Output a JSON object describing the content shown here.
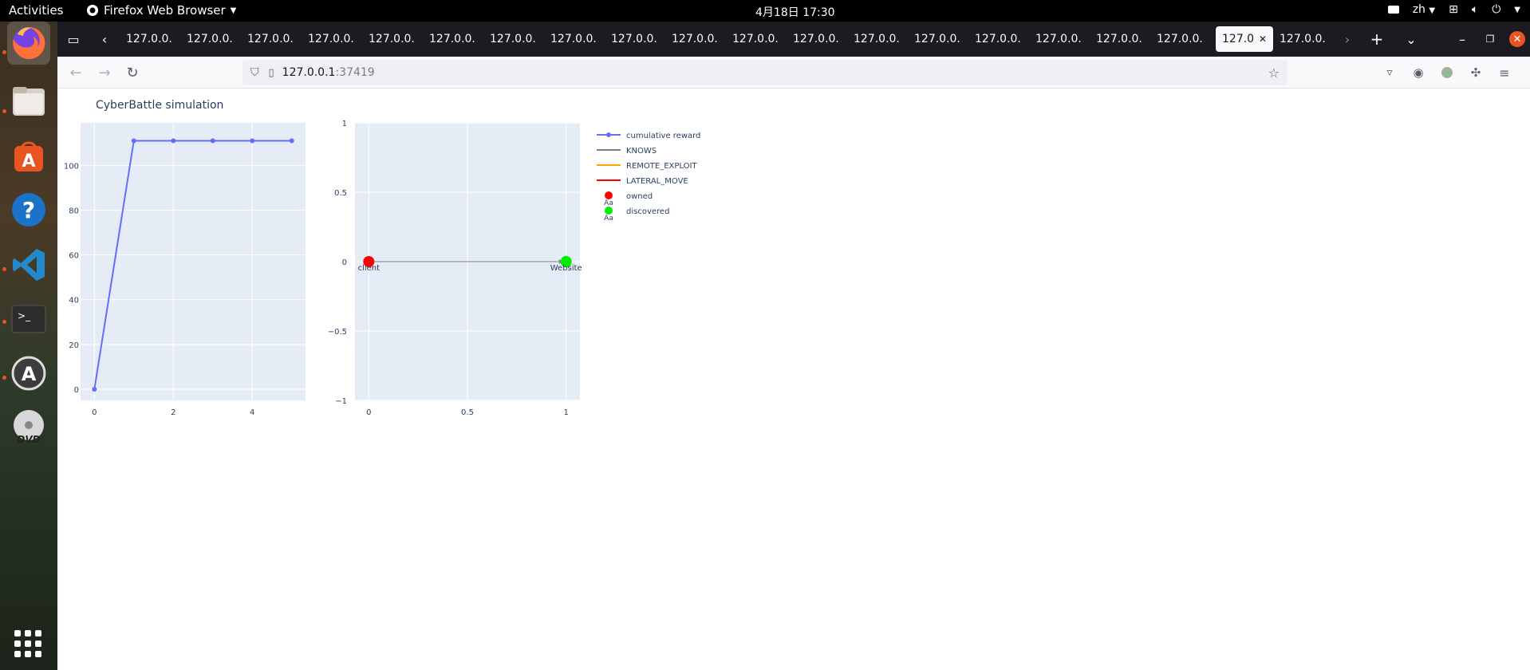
{
  "topbar": {
    "activities": "Activities",
    "app_name": "Firefox Web Browser",
    "clock": "4月18日  17:30",
    "input_method": "zh"
  },
  "browser": {
    "tabs": [
      {
        "label": "127.0.0."
      },
      {
        "label": "127.0.0."
      },
      {
        "label": "127.0.0."
      },
      {
        "label": "127.0.0."
      },
      {
        "label": "127.0.0."
      },
      {
        "label": "127.0.0."
      },
      {
        "label": "127.0.0."
      },
      {
        "label": "127.0.0."
      },
      {
        "label": "127.0.0."
      },
      {
        "label": "127.0.0."
      },
      {
        "label": "127.0.0."
      },
      {
        "label": "127.0.0."
      },
      {
        "label": "127.0.0."
      },
      {
        "label": "127.0.0."
      },
      {
        "label": "127.0.0."
      },
      {
        "label": "127.0.0."
      },
      {
        "label": "127.0.0."
      },
      {
        "label": "127.0.0."
      },
      {
        "label": "127.0",
        "active": true
      },
      {
        "label": "127.0.0."
      }
    ],
    "url_host": "127.0.0.1",
    "url_port": ":37419"
  },
  "dock": {
    "apps": [
      "firefox-icon",
      "files-icon",
      "app-center-icon",
      "help-icon",
      "vscode-icon",
      "terminal-icon",
      "software-updater-icon",
      "dvd-icon"
    ]
  },
  "page": {
    "title": "CyberBattle simulation"
  },
  "chart_data": [
    {
      "type": "line",
      "series": [
        {
          "name": "cumulative reward",
          "x": [
            0,
            1,
            2,
            3,
            4,
            5
          ],
          "y": [
            0,
            111,
            111,
            111,
            111,
            111
          ]
        }
      ],
      "xticks": [
        "0",
        "2",
        "4"
      ],
      "yticks": [
        "0",
        "20",
        "40",
        "60",
        "80",
        "100"
      ],
      "xlim": [
        -0.35,
        5.35
      ],
      "ylim": [
        -5,
        119
      ],
      "grid": true,
      "color": "#636efa"
    },
    {
      "type": "scatter",
      "nodes": [
        {
          "name": "client",
          "x": 0,
          "y": 0,
          "status": "owned",
          "color": "#ff0000"
        },
        {
          "name": "Website",
          "x": 1,
          "y": 0,
          "status": "discovered",
          "color": "#00ee00"
        }
      ],
      "edges": [
        {
          "from": "client",
          "to": "Website",
          "kind": "KNOWS",
          "color": "#808080"
        }
      ],
      "xticks": [
        "0",
        "0.5",
        "1"
      ],
      "yticks": [
        "1",
        "0.5",
        "0",
        "−0.5",
        "−1"
      ],
      "xlim": [
        -0.07,
        1.07
      ],
      "ylim": [
        -1,
        1
      ],
      "grid": true
    }
  ],
  "legend": {
    "placement": "right",
    "items": [
      {
        "label": "cumulative reward",
        "color": "#636efa",
        "kind": "line-marker"
      },
      {
        "label": "KNOWS",
        "color": "#808080",
        "kind": "line"
      },
      {
        "label": "REMOTE_EXPLOIT",
        "color": "#ffa500",
        "kind": "line"
      },
      {
        "label": "LATERAL_MOVE",
        "color": "#ff0000",
        "kind": "line"
      },
      {
        "label": "owned",
        "color": "#ff0000",
        "kind": "marker-text",
        "glyph": "Aa"
      },
      {
        "label": "discovered",
        "color": "#00ee00",
        "kind": "marker-text",
        "glyph": "Aa"
      }
    ]
  }
}
